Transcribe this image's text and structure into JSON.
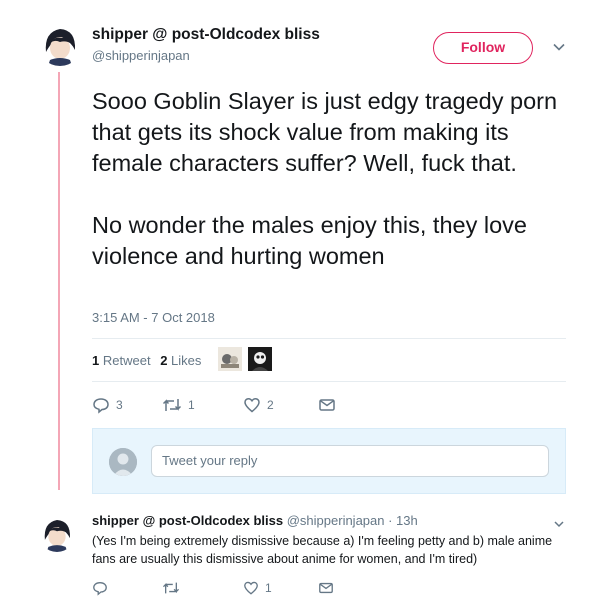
{
  "tweet": {
    "display_name": "shipper @ post-Oldcodex bliss",
    "handle": "@shipperinjapan",
    "follow_label": "Follow",
    "text": "Sooo Goblin Slayer is just edgy tragedy porn that gets its shock value from making its female characters suffer? Well, fuck that.\n\nNo wonder the males enjoy this, they love violence and hurting women",
    "timestamp": "3:15 AM - 7 Oct 2018",
    "retweet_count": "1",
    "retweet_label": "Retweet",
    "like_count": "2",
    "like_label": "Likes",
    "actions": {
      "reply_count": "3",
      "retweet_count": "1",
      "like_count": "2"
    }
  },
  "reply_box": {
    "placeholder": "Tweet your reply"
  },
  "reply_tweet": {
    "display_name": "shipper @ post-Oldcodex bliss",
    "meta": "@shipperinjapan · 13h",
    "text": "(Yes I'm being extremely dismissive because a) I'm feeling petty and b) male anime fans are usually this dismissive about anime for women, and I'm tired)",
    "actions": {
      "like_count": "1"
    }
  },
  "colors": {
    "accent": "#e0245e",
    "thread_line": "#f4a6b6",
    "muted": "#657786",
    "link_blue": "#1da1f2"
  },
  "icons": [
    "reply-icon",
    "retweet-icon",
    "like-icon",
    "message-icon",
    "chevron-down-icon"
  ]
}
